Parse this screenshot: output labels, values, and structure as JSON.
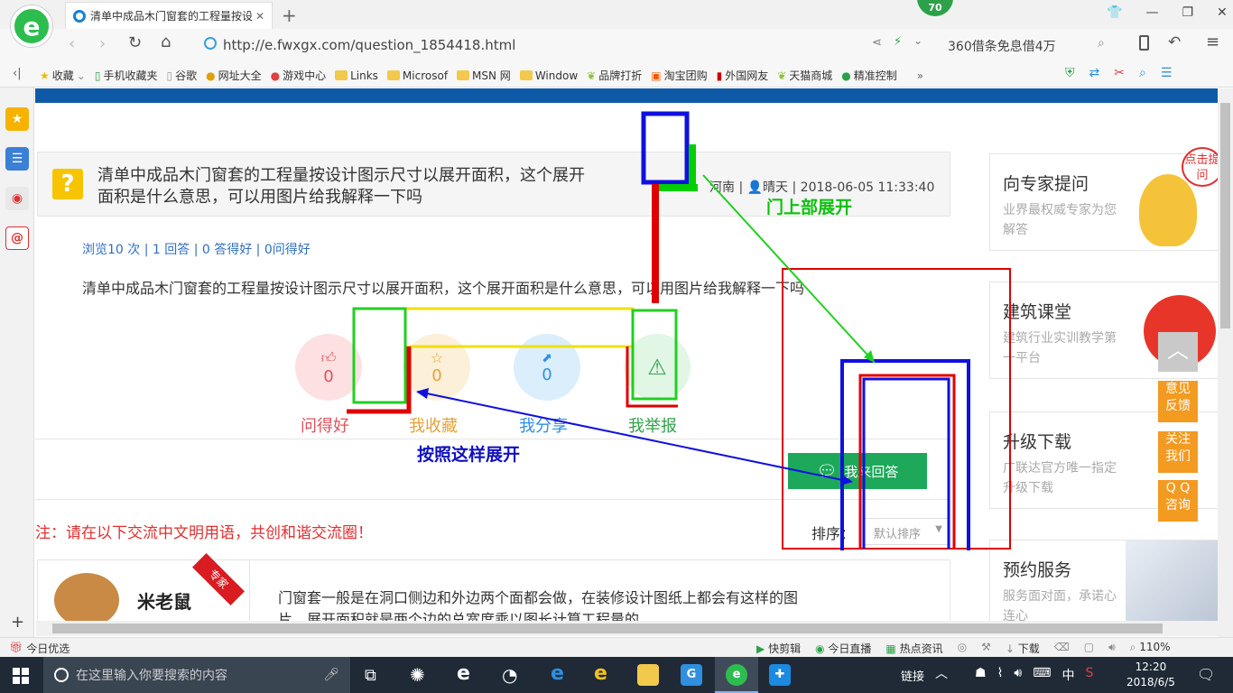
{
  "browser": {
    "badge": "70",
    "tab_title": "清单中成品木门窗套的工程量按设",
    "url": "http://e.fwxgx.com/question_1854418.html",
    "search_placeholder": "360借条免息借4万",
    "bookmarks": [
      "收藏",
      "手机收藏夹",
      "谷歌",
      "网址大全",
      "游戏中心",
      "Links",
      "Microsof",
      "MSN 网",
      "Window",
      "品牌打折",
      "淘宝团购",
      "外国网友",
      "天猫商城",
      "精准控制"
    ],
    "more": "»"
  },
  "question": {
    "title_line1": "清单中成品木门窗套的工程量按设计图示尺寸以展开面积，这个展开",
    "title_line2": "面积是什么意思，可以用图片给我解释一下吗",
    "meta": "河南 | 👤晴天 | 2018-06-05 11:33:40",
    "stats": "浏览10 次 | 1 回答 | 0 答得好 | 0问得好",
    "body": "清单中成品木门窗套的工程量按设计图示尺寸以展开面积，这个展开面积是什么意思，可以用图片给我解释一下吗"
  },
  "actions": [
    {
      "label": "问得好",
      "count": "0",
      "color": "#e0525a",
      "bg": "#fde1e2"
    },
    {
      "label": "我收藏",
      "count": "0",
      "color": "#e3a236",
      "bg": "#fdf0d9"
    },
    {
      "label": "我分享",
      "count": "0",
      "color": "#2f8fe0",
      "bg": "#dbeefc"
    },
    {
      "label": "我举报",
      "count": "",
      "color": "#2fa24a",
      "bg": "#e2f6e6"
    }
  ],
  "answer_button": "我来回答",
  "notice": "注：请在以下交流中文明用语，共创和谐交流圈！",
  "sort": {
    "label": "排序：",
    "selected": "默认排序"
  },
  "answer": {
    "badge": "专家",
    "author": "米老鼠",
    "text_line1": "门窗套一般是在洞口侧边和外边两个面都会做，在装修设计图纸上都会有这样的图",
    "text_line2": "片，展开面积就是两个边的总宽度乘以图长计算工程量的"
  },
  "annotations": {
    "top_label": "门上部展开",
    "bottom_label": "按照这样展开"
  },
  "sidebar": [
    {
      "title": "向专家提问",
      "sub": "业界最权威专家为您解答",
      "bubble": "点击提问"
    },
    {
      "title": "建筑课堂",
      "sub": "建筑行业实训教学第一平台"
    },
    {
      "title": "升级下载",
      "sub": "广联达官方唯一指定升级下载"
    },
    {
      "title": "预约服务",
      "sub": "服务面对面，承诺心连心"
    }
  ],
  "float_buttons": [
    "意见反馈",
    "关注我们",
    "Q Q咨询"
  ],
  "statusbar": {
    "left": "今日优选",
    "items": [
      "快剪辑",
      "今日直播",
      "热点资讯",
      "下载"
    ],
    "zoom": "110%"
  },
  "taskbar": {
    "search": "在这里输入你要搜索的内容",
    "tray_label": "链接",
    "ime": "中",
    "time": "12:20",
    "date": "2018/6/5"
  }
}
